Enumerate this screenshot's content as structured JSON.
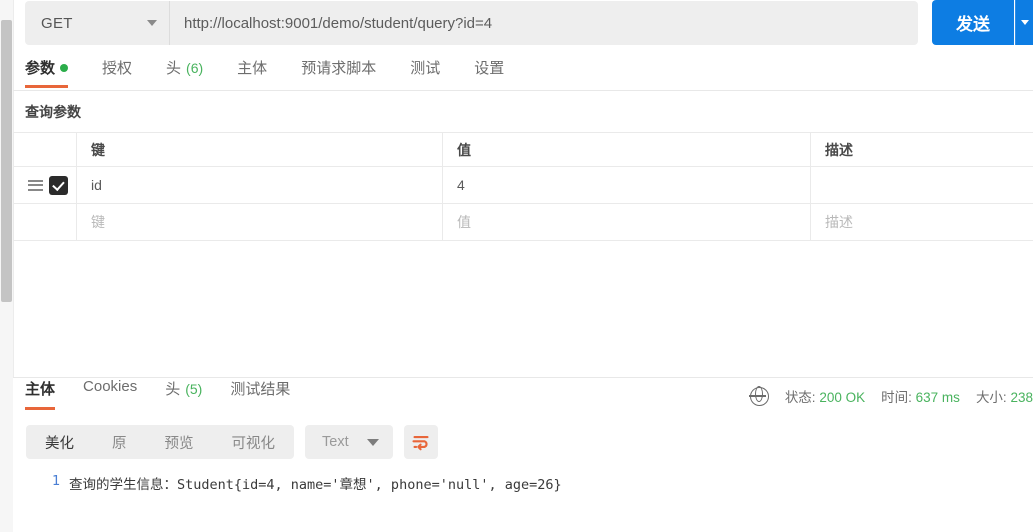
{
  "request": {
    "method": "GET",
    "url": "http://localhost:9001/demo/student/query?id=4",
    "send_label": "发送",
    "tabs": [
      {
        "label": "参数",
        "badge": "",
        "dot": true,
        "active": true
      },
      {
        "label": "授权",
        "badge": "",
        "dot": false,
        "active": false
      },
      {
        "label": "头",
        "badge": "(6)",
        "dot": false,
        "active": false
      },
      {
        "label": "主体",
        "badge": "",
        "dot": false,
        "active": false
      },
      {
        "label": "预请求脚本",
        "badge": "",
        "dot": false,
        "active": false
      },
      {
        "label": "测试",
        "badge": "",
        "dot": false,
        "active": false
      },
      {
        "label": "设置",
        "badge": "",
        "dot": false,
        "active": false
      }
    ],
    "section_label": "查询参数",
    "table": {
      "headers": [
        "",
        "键",
        "值",
        "描述"
      ],
      "rows": [
        {
          "enabled": true,
          "key": "id",
          "value": "4",
          "description": ""
        }
      ],
      "placeholder_row": {
        "key": "键",
        "value": "值",
        "description": "描述"
      }
    }
  },
  "response": {
    "tabs": [
      {
        "label": "主体",
        "badge": "",
        "active": true
      },
      {
        "label": "Cookies",
        "badge": "",
        "active": false
      },
      {
        "label": "头",
        "badge": "(5)",
        "active": false
      },
      {
        "label": "测试结果",
        "badge": "",
        "active": false
      }
    ],
    "status": {
      "status_label": "状态:",
      "status_value": "200 OK",
      "time_label": "时间:",
      "time_value": "637 ms",
      "size_label": "大小:",
      "size_value": "238"
    },
    "toolbar": {
      "segments": [
        {
          "label": "美化",
          "active": true
        },
        {
          "label": "原",
          "active": false
        },
        {
          "label": "预览",
          "active": false
        },
        {
          "label": "可视化",
          "active": false
        }
      ],
      "format": "Text"
    },
    "body": {
      "line_number": "1",
      "text": "查询的学生信息：Student{id=4, name='章想', phone='null', age=26}"
    }
  },
  "colors": {
    "accent_orange": "#e8663a",
    "send_blue": "#0d7de3",
    "status_green": "#49b35e",
    "dot_green": "#2bad4a"
  }
}
